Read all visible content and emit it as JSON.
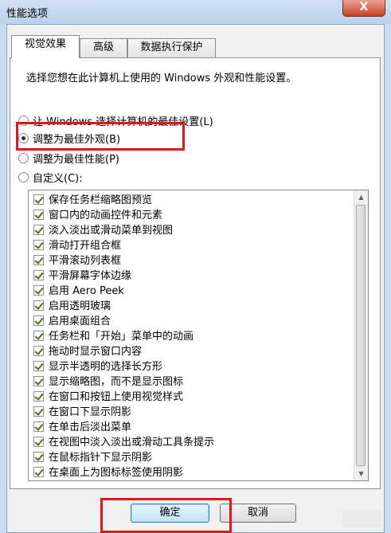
{
  "window": {
    "title": "性能选项",
    "close_glyph": "X"
  },
  "tabs": [
    {
      "label": "视觉效果",
      "active": true
    },
    {
      "label": "高级",
      "active": false
    },
    {
      "label": "数据执行保护",
      "active": false
    }
  ],
  "description": "选择您想在此计算机上使用的 Windows 外观和性能设置。",
  "radios": [
    {
      "label": "让 Windows 选择计算机的最佳设置(L)",
      "selected": false
    },
    {
      "label": "调整为最佳外观(B)",
      "selected": true
    },
    {
      "label": "调整为最佳性能(P)",
      "selected": false
    },
    {
      "label": "自定义(C):",
      "selected": false
    }
  ],
  "effects": [
    {
      "label": "保存任务栏缩略图预览",
      "checked": true
    },
    {
      "label": "窗口内的动画控件和元素",
      "checked": true
    },
    {
      "label": "淡入淡出或滑动菜单到视图",
      "checked": true
    },
    {
      "label": "滑动打开组合框",
      "checked": true
    },
    {
      "label": "平滑滚动列表框",
      "checked": true
    },
    {
      "label": "平滑屏幕字体边缘",
      "checked": true
    },
    {
      "label": "启用 Aero Peek",
      "checked": true
    },
    {
      "label": "启用透明玻璃",
      "checked": true
    },
    {
      "label": "启用桌面组合",
      "checked": true
    },
    {
      "label": "任务栏和「开始」菜单中的动画",
      "checked": true
    },
    {
      "label": "拖动时显示窗口内容",
      "checked": true
    },
    {
      "label": "显示半透明的选择长方形",
      "checked": true
    },
    {
      "label": "显示缩略图，而不是显示图标",
      "checked": true
    },
    {
      "label": "在窗口和按钮上使用视觉样式",
      "checked": true
    },
    {
      "label": "在窗口下显示阴影",
      "checked": true
    },
    {
      "label": "在单击后淡出菜单",
      "checked": true
    },
    {
      "label": "在视图中淡入淡出或滑动工具条提示",
      "checked": true
    },
    {
      "label": "在鼠标指针下显示阴影",
      "checked": true
    },
    {
      "label": "在桌面上为图标标签使用阴影",
      "checked": true
    }
  ],
  "buttons": {
    "ok": "确定",
    "cancel": "取消"
  },
  "colors": {
    "highlight": "#e0161d",
    "selected_radio": "#2d2d2d"
  }
}
